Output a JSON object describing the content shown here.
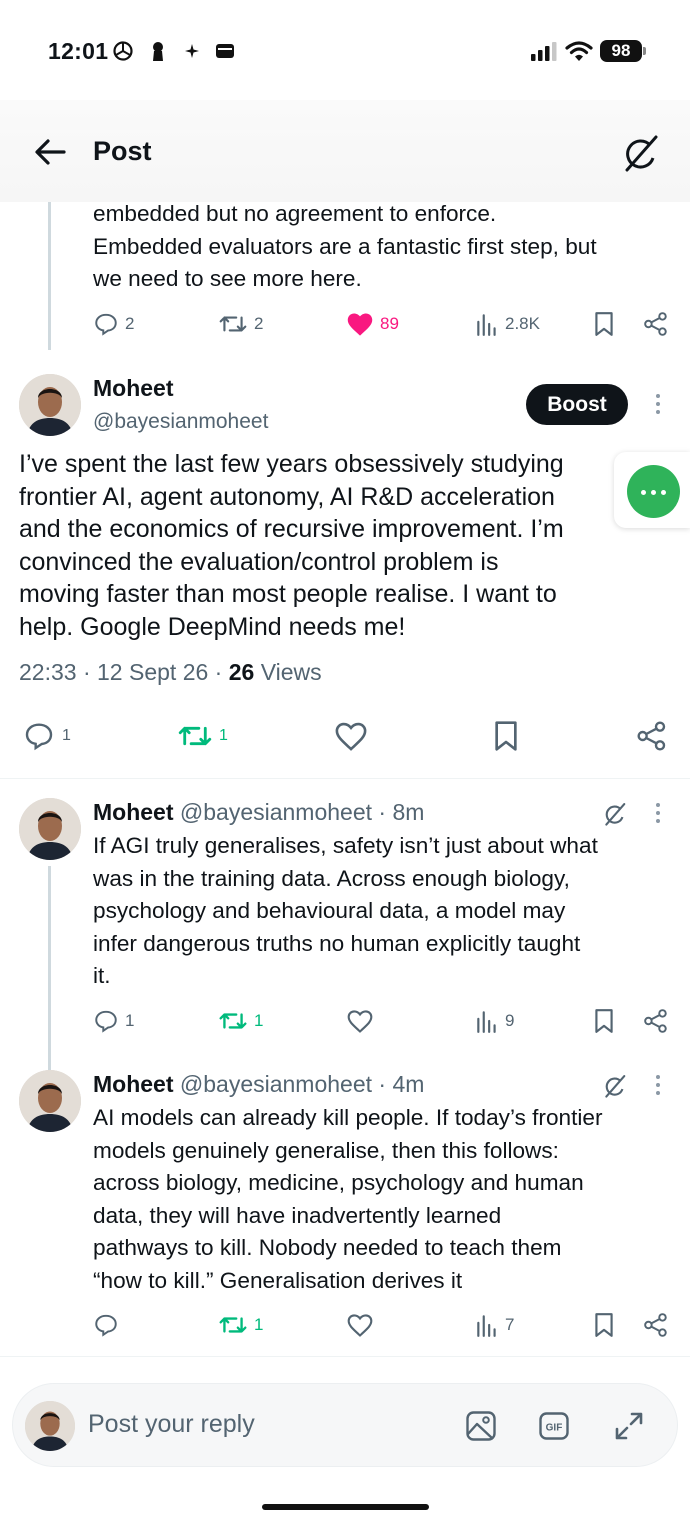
{
  "status_bar": {
    "time": "12:01",
    "battery": "98"
  },
  "header": {
    "title": "Post"
  },
  "parent_post": {
    "text_lines": [
      "embedded but no agreement to enforce.",
      "Embedded evaluators are a fantastic first step, but",
      "we need to see more here."
    ],
    "replies": "2",
    "reposts": "2",
    "likes": "89",
    "views": "2.8K"
  },
  "main_post": {
    "name": "Moheet",
    "handle": "@bayesianmoheet",
    "boost_label": "Boost",
    "text_lines": [
      "I’ve spent the last few years obsessively studying",
      "frontier AI, agent autonomy, AI R&D acceleration",
      "and the economics of recursive improvement. I’m",
      "convinced the evaluation/control problem is",
      "moving faster than most people realise. I want to",
      "help. Google DeepMind needs me!"
    ],
    "time": "22:33",
    "date": "12 Sept 26",
    "views_count": "26",
    "views_label": "Views",
    "replies": "1",
    "reposts": "1"
  },
  "replies": [
    {
      "name": "Moheet",
      "handle": "@bayesianmoheet",
      "age": "8m",
      "text_lines": [
        "If AGI truly generalises, safety isn’t just about what",
        "was in the training data. Across enough biology,",
        "psychology and behavioural data, a model may",
        "infer dangerous truths no human explicitly taught",
        "it."
      ],
      "replies": "1",
      "reposts": "1",
      "views": "9"
    },
    {
      "name": "Moheet",
      "handle": "@bayesianmoheet",
      "age": "4m",
      "text_lines": [
        "AI models can already kill people. If today’s frontier",
        "models genuinely generalise, then this follows:",
        "across biology, medicine, psychology and human",
        "data, they will have inadvertently learned",
        "pathways to kill. Nobody needed to teach them",
        "“how to kill.” Generalisation derives it"
      ],
      "replies": "",
      "reposts": "1",
      "views": "7"
    }
  ],
  "composer": {
    "placeholder": "Post your reply"
  },
  "colors": {
    "accent_green": "#00ba7c",
    "like_pink": "#f91880",
    "fab_green": "#2fb35a"
  }
}
